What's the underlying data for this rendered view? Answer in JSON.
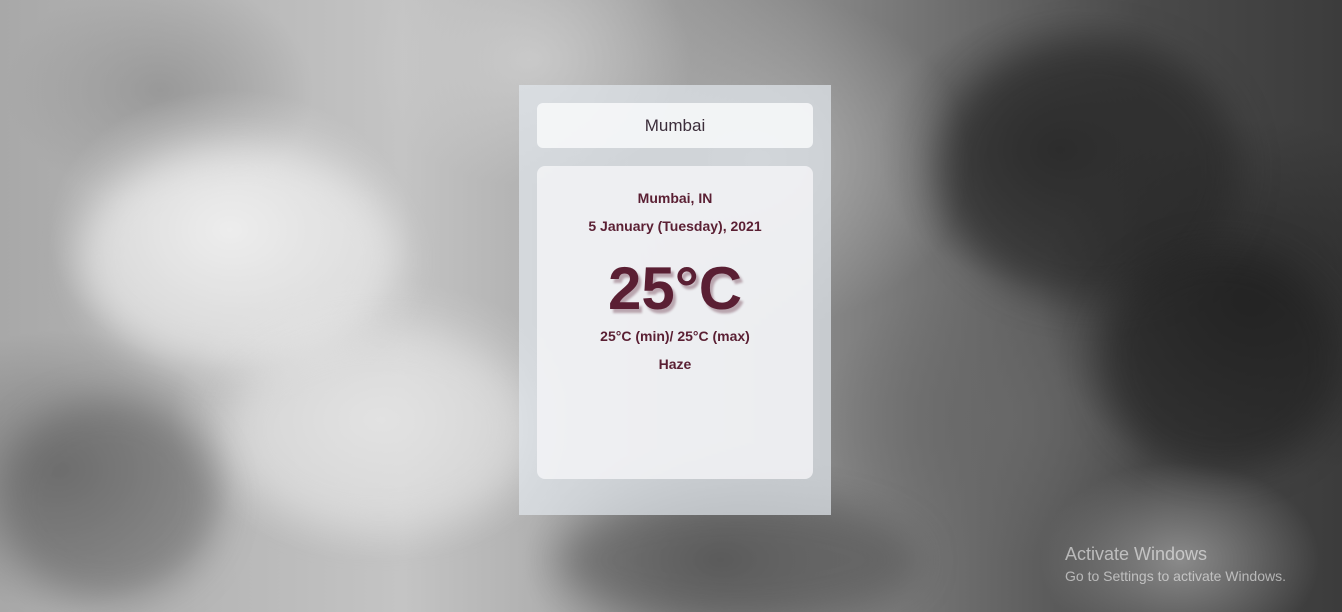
{
  "search": {
    "value": "Mumbai"
  },
  "weather": {
    "location": "Mumbai, IN",
    "date": "5 January (Tuesday), 2021",
    "temperature": "25°C",
    "min_max": "25°C (min)/ 25°C (max)",
    "condition": "Haze"
  },
  "os_watermark": {
    "title": "Activate Windows",
    "subtitle": "Go to Settings to activate Windows."
  },
  "colors": {
    "text_accent": "#5a1f33",
    "panel": "#e1e6eb"
  }
}
